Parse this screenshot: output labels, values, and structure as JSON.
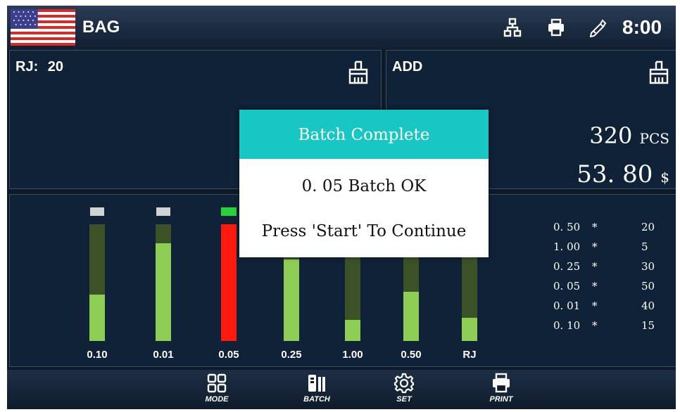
{
  "header": {
    "mode": "BAG",
    "clock": "8:00",
    "icons": [
      "us-flag",
      "network-icon",
      "printer-icon",
      "pen-icon"
    ]
  },
  "left_panel": {
    "label": "RJ:",
    "value": "20"
  },
  "right_panel": {
    "label": "ADD",
    "count": "320",
    "count_unit": "PCS",
    "amount": "53. 80",
    "amount_unit": "$"
  },
  "bars": [
    {
      "label": "0.10",
      "fill": 0.4,
      "cap": "gray"
    },
    {
      "label": "0.01",
      "fill": 0.84,
      "cap": "gray"
    },
    {
      "label": "0.05",
      "fill": 1.0,
      "cap": "green",
      "state": "full"
    },
    {
      "label": "0.25",
      "fill": 0.7,
      "cap": "hidden"
    },
    {
      "label": "1.00",
      "fill": 0.18,
      "cap": "hidden"
    },
    {
      "label": "0.50",
      "fill": 0.42,
      "cap": "hidden"
    },
    {
      "label": "RJ",
      "fill": 0.2,
      "cap": "hidden"
    }
  ],
  "batch_table": [
    {
      "denom": "0. 50",
      "op": "*",
      "qty": "20"
    },
    {
      "denom": "1. 00",
      "op": "*",
      "qty": "5"
    },
    {
      "denom": "0. 25",
      "op": "*",
      "qty": "30"
    },
    {
      "denom": "0. 05",
      "op": "*",
      "qty": "50"
    },
    {
      "denom": "0. 01",
      "op": "*",
      "qty": "40"
    },
    {
      "denom": "0. 10",
      "op": "*",
      "qty": "15"
    }
  ],
  "toolbar": [
    {
      "label": "MODE",
      "icon": "grid-icon"
    },
    {
      "label": "BATCH",
      "icon": "batch-icon"
    },
    {
      "label": "SET",
      "icon": "gear-icon"
    },
    {
      "label": "PRINT",
      "icon": "printer-icon"
    }
  ],
  "dialog": {
    "title": "Batch Complete",
    "message": "0. 05 Batch OK",
    "prompt": "Press 'Start' To Continue"
  },
  "colors": {
    "accent": "#18c6c3",
    "bar_fill": "#8fce55",
    "bar_track": "#3b5227",
    "bar_full": "#ff1a10",
    "cap_green": "#25d33a"
  }
}
